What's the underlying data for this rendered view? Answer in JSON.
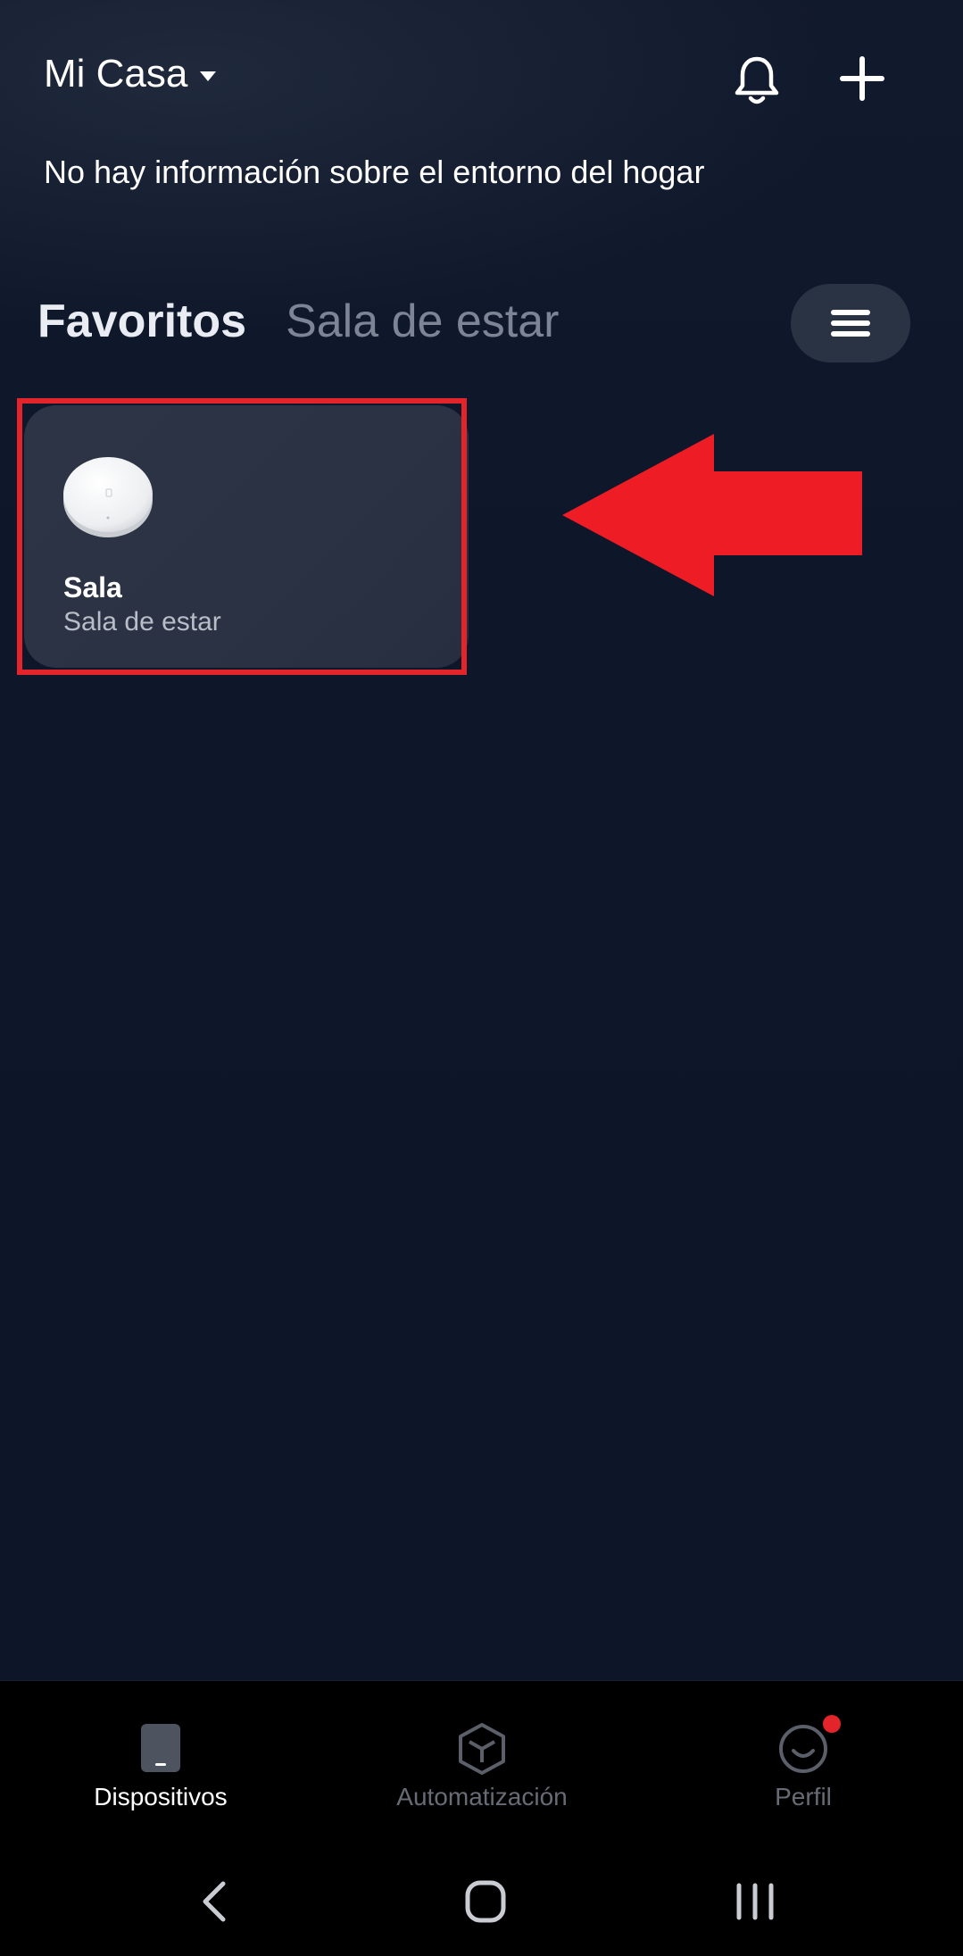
{
  "header": {
    "home_name": "Mi Casa",
    "env_info": "No hay información sobre el entorno del hogar",
    "icons": [
      "chevron-down-icon",
      "bell-icon",
      "plus-icon"
    ]
  },
  "tabs": [
    {
      "label": "Favoritos",
      "active": true
    },
    {
      "label": "Sala de estar",
      "active": false
    }
  ],
  "menu_button": {
    "icon": "hamburger-menu-icon"
  },
  "devices": [
    {
      "name": "Sala",
      "room": "Sala de estar",
      "icon": "hub-device-image"
    }
  ],
  "annotation": {
    "highlight_color": "#e3242b",
    "arrow_color": "#ee1c25",
    "arrow_direction": "left"
  },
  "bottom_nav": [
    {
      "label": "Dispositivos",
      "icon": "device-icon",
      "active": true
    },
    {
      "label": "Automatización",
      "icon": "cube-icon",
      "active": false
    },
    {
      "label": "Perfil",
      "icon": "smile-icon",
      "active": false,
      "badge": true
    }
  ],
  "system_nav": [
    "back-icon",
    "home-icon",
    "recents-icon"
  ],
  "colors": {
    "background": "#0d1628",
    "card": "#2c3446",
    "accent_red": "#e3242b",
    "nav_bg": "#000000"
  }
}
